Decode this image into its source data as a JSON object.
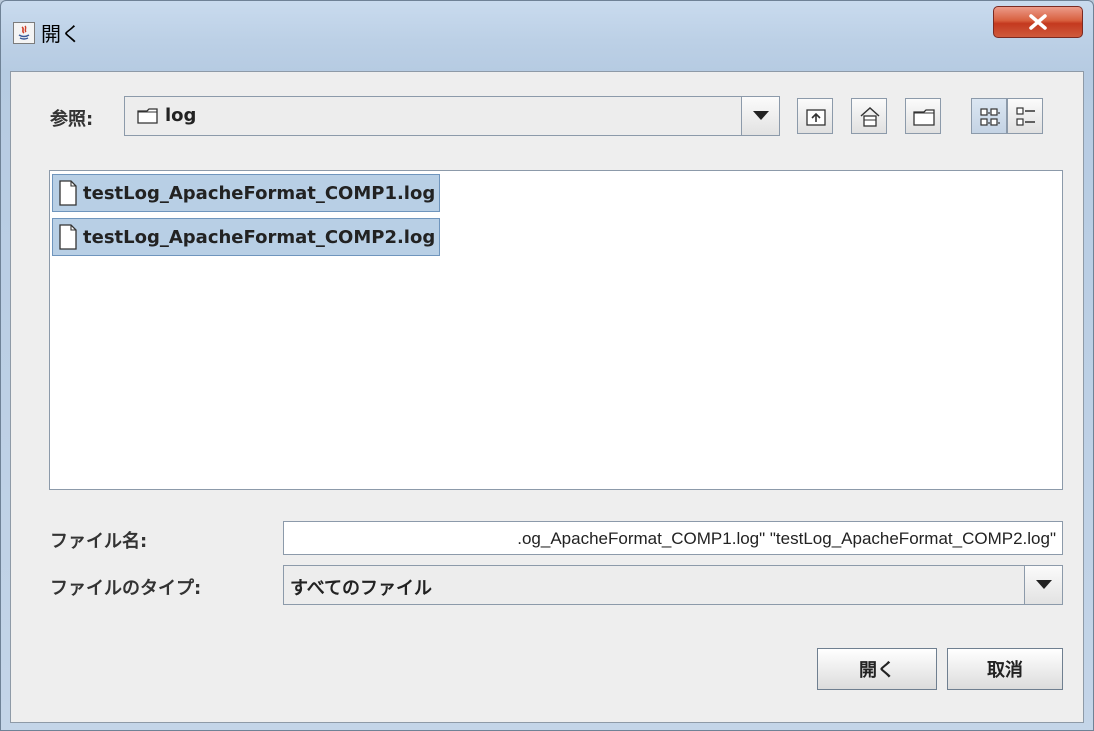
{
  "window": {
    "title": "開く",
    "close_label": "X"
  },
  "look_in": {
    "label": "参照:",
    "value": "log"
  },
  "toolbar": {
    "buttons": [
      "up-one-level-icon",
      "home-icon",
      "new-folder-icon",
      "list-view-icon",
      "details-view-icon"
    ]
  },
  "files": [
    {
      "name": "testLog_ApacheFormat_COMP1.log",
      "selected": true
    },
    {
      "name": "testLog_ApacheFormat_COMP2.log",
      "selected": true
    }
  ],
  "file_name": {
    "label": "ファイル名:",
    "value": ".og_ApacheFormat_COMP1.log\" \"testLog_ApacheFormat_COMP2.log\""
  },
  "file_type": {
    "label": "ファイルのタイプ:",
    "value": "すべてのファイル"
  },
  "buttons": {
    "open": "開く",
    "cancel": "取消"
  },
  "colors": {
    "selection_bg": "#b8cfe5",
    "selection_border": "#6f95bd",
    "close_button": "#c4391f"
  }
}
